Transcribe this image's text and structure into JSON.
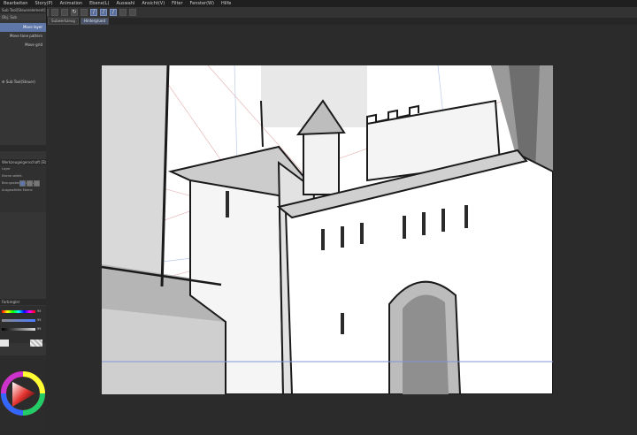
{
  "menu": [
    {
      "label": "Bearbeiten",
      "name": "menu-bearbeiten"
    },
    {
      "label": "Story(P)",
      "name": "menu-story"
    },
    {
      "label": "Animation",
      "name": "menu-animation"
    },
    {
      "label": "Ebene(L)",
      "name": "menu-ebene"
    },
    {
      "label": "Auswahl",
      "name": "menu-auswahl"
    },
    {
      "label": "Ansicht(V)",
      "name": "menu-ansicht"
    },
    {
      "label": "Filter",
      "name": "menu-filter"
    },
    {
      "label": "Fenster(W)",
      "name": "menu-fenster"
    },
    {
      "label": "Hilfe",
      "name": "menu-hilfe"
    }
  ],
  "tabs": [
    {
      "label": "Subwerkzeug",
      "active": false
    },
    {
      "label": "Hintergrund",
      "active": true
    }
  ],
  "subtool_panel": {
    "header": "Sub Tool[Steuerelement]",
    "top_item": "Obj. Sub",
    "items": [
      {
        "label": "Move layer",
        "selected": true
      },
      {
        "label": "Move tone pattern",
        "selected": false
      },
      {
        "label": "Move grid",
        "selected": false
      }
    ],
    "group_label": "Sub Tool(Steuer)"
  },
  "tool_property": {
    "header": "Werkzeugeigenschaft [Ebene]",
    "rows": [
      "Layer",
      "Ebene selekt.",
      "Bezugsebene in Bearb.",
      "Ausgewählte Ebene"
    ]
  },
  "color_slider": {
    "header": "Farbregler",
    "values": [
      "95",
      "95",
      "95"
    ]
  },
  "colors": {
    "accent": "#5f77a8",
    "panel_bg": "#353535",
    "canvas_bg": "#ffffff",
    "workspace_bg": "#2b2b2b"
  },
  "icons": [
    "hand-icon",
    "zoom-icon",
    "rotate-icon",
    "undo-icon",
    "redo-icon",
    "pen-icon",
    "ruler-icon"
  ]
}
